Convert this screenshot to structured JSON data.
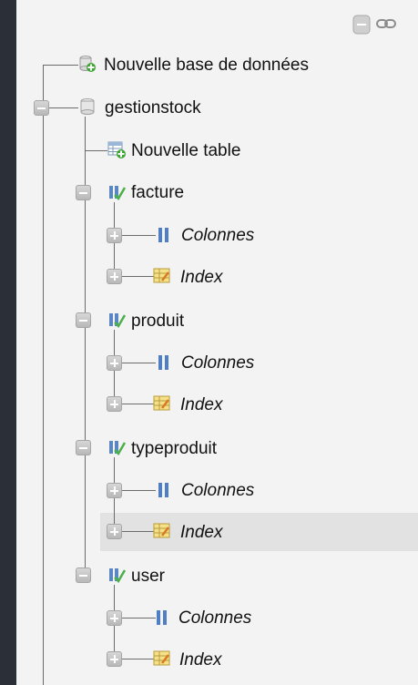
{
  "controls": {
    "collapse_all": "collapse-all-icon",
    "link_with_main": "link-icon"
  },
  "tree": {
    "new_database": "Nouvelle base de données",
    "database": {
      "name": "gestionstock",
      "new_table": "Nouvelle table",
      "tables": [
        {
          "name": "facture",
          "columns": "Colonnes",
          "index": "Index"
        },
        {
          "name": "produit",
          "columns": "Colonnes",
          "index": "Index"
        },
        {
          "name": "typeproduit",
          "columns": "Colonnes",
          "index": "Index"
        },
        {
          "name": "user",
          "columns": "Colonnes",
          "index": "Index"
        }
      ]
    }
  },
  "colors": {
    "background": "#2b3038",
    "panel": "#f3f3f3",
    "hover_row": "#e2e2e2"
  }
}
